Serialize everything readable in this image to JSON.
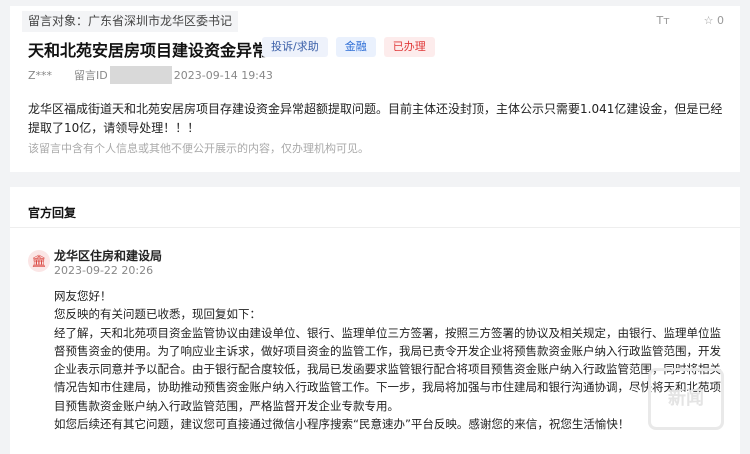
{
  "message": {
    "target": "留言对象：广东省深圳市龙华区委书记",
    "font_size_icon_label": "Tт",
    "favorite_count": "☆ 0",
    "title": "天和北苑安居房项目建设资金异常",
    "tags": [
      "投诉/求助",
      "金融",
      "已办理"
    ],
    "author": "Z***",
    "id_label": "留言ID",
    "date": "2023-09-14 19:43",
    "content": "龙华区福成街道天和北苑安居房项目存建设资金异常超额提取问题。目前主体还没封顶，主体公示只需要1.041亿建设金，但是已经提取了10亿，请领导处理！！！",
    "privacy_hint": "该留言中含有个人信息或其他不便公开展示的内容，仅办理机构可见。"
  },
  "reply": {
    "section_title": "官方回复",
    "org_icon": "🏛",
    "org_name": "龙华区住房和建设局",
    "time": "2023-09-22 20:26",
    "paragraphs": [
      "网友您好！",
      "您反映的有关问题已收悉，现回复如下：",
      "经了解，天和北苑项目资金监管协议由建设单位、银行、监理单位三方签署，按照三方签署的协议及相关规定，由银行、监理单位监督预售资金的使用。为了响应业主诉求，做好项目资金的监管工作，我局已责令开发企业将预售款资金账户纳入行政监管范围，开发企业表示同意并予以配合。由于银行配合度较低，我局已发函要求监管银行配合将项目预售资金账户纳入行政监管范围，同时将相关情况告知市住建局，协助推动预售资金账户纳入行政监管工作。下一步，我局将加强与市住建局和银行沟通协调，尽快将天和北苑项目预售款资金账户纳入行政监管范围，严格监督开发企业专款专用。",
      "如您后续还有其它问题，建议您可直接通过微信小程序搜索“民意速办”平台反映。感谢您的来信，祝您生活愉快！"
    ],
    "watermark": "新闻"
  }
}
